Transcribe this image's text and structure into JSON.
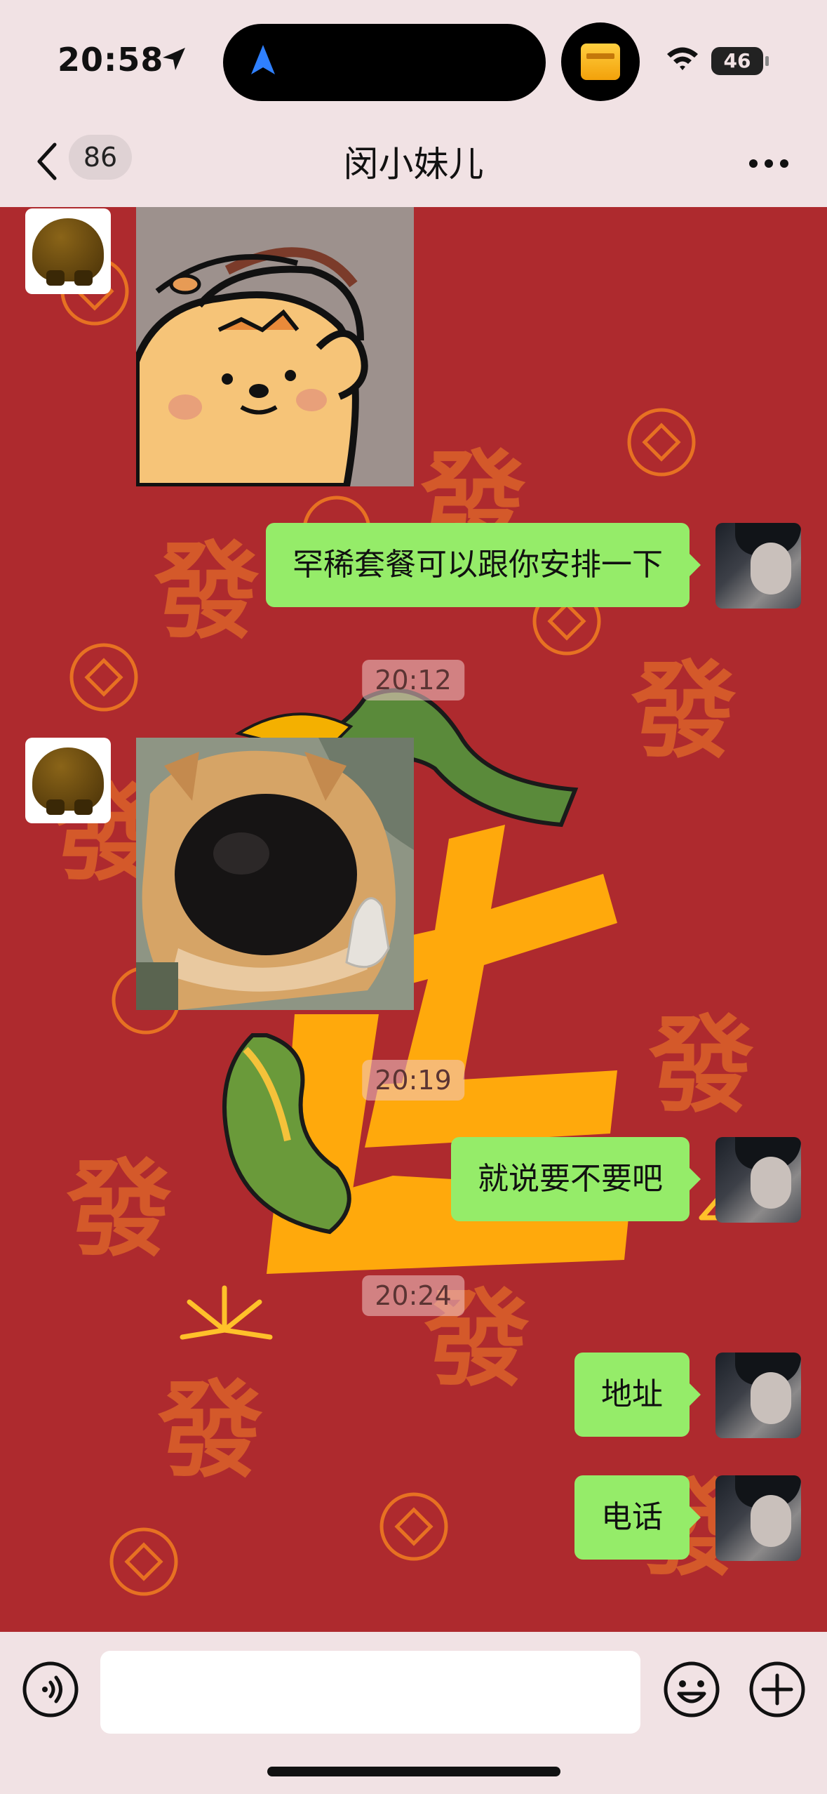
{
  "status_bar": {
    "time": "20:58",
    "battery": "46"
  },
  "header": {
    "unread_count": "86",
    "title": "闵小妹儿"
  },
  "messages": [
    {
      "type": "image",
      "sender": "contact",
      "content": "bear-with-headphones-sticker"
    },
    {
      "type": "text",
      "sender": "me",
      "text": "罕稀套餐可以跟你安排一下"
    },
    {
      "type": "time",
      "text": "20:12"
    },
    {
      "type": "image",
      "sender": "contact",
      "content": "dog-nose-thumbs-up-meme"
    },
    {
      "type": "time",
      "text": "20:19"
    },
    {
      "type": "text",
      "sender": "me",
      "text": "就说要不要吧"
    },
    {
      "type": "time",
      "text": "20:24"
    },
    {
      "type": "text",
      "sender": "me",
      "text": "地址"
    },
    {
      "type": "text",
      "sender": "me",
      "text": "电话"
    }
  ],
  "input_bar": {
    "placeholder": "",
    "value": ""
  },
  "icons": [
    "location-arrow-icon",
    "navigation-icon",
    "package-icon",
    "wifi-icon",
    "back-chevron-icon",
    "more-dots-icon",
    "voice-icon",
    "emoji-icon",
    "plus-icon"
  ],
  "colors": {
    "chat_background": "#ae2a2e",
    "sent_bubble": "#95ec69",
    "ornament": "#ffa90c"
  }
}
